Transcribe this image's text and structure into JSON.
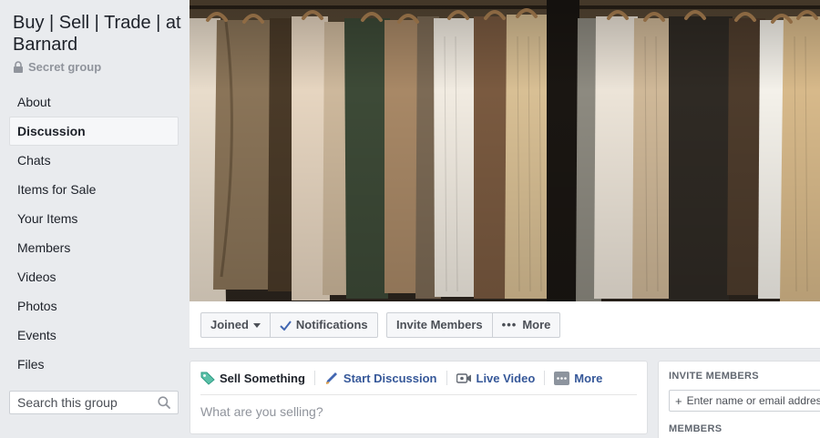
{
  "group": {
    "title": "Buy | Sell | Trade | at Barnard",
    "privacy": "Secret group"
  },
  "sidebar": {
    "items": [
      {
        "label": "About"
      },
      {
        "label": "Discussion",
        "active": true
      },
      {
        "label": "Chats"
      },
      {
        "label": "Items for Sale"
      },
      {
        "label": "Your Items"
      },
      {
        "label": "Members"
      },
      {
        "label": "Videos"
      },
      {
        "label": "Photos"
      },
      {
        "label": "Events"
      },
      {
        "label": "Files"
      }
    ],
    "search_placeholder": "Search this group"
  },
  "actions": {
    "joined": "Joined",
    "notifications": "Notifications",
    "invite": "Invite Members",
    "more": "More"
  },
  "composer": {
    "tabs": {
      "sell": "Sell Something",
      "discussion": "Start Discussion",
      "video": "Live Video",
      "more": "More"
    },
    "placeholder": "What are you selling?"
  },
  "right": {
    "invite_heading": "INVITE MEMBERS",
    "invite_placeholder": "Enter name or email address",
    "members_heading": "MEMBERS"
  },
  "colors": {
    "page_bg": "#e9ebee",
    "link": "#365899",
    "check": "#4267b2"
  }
}
